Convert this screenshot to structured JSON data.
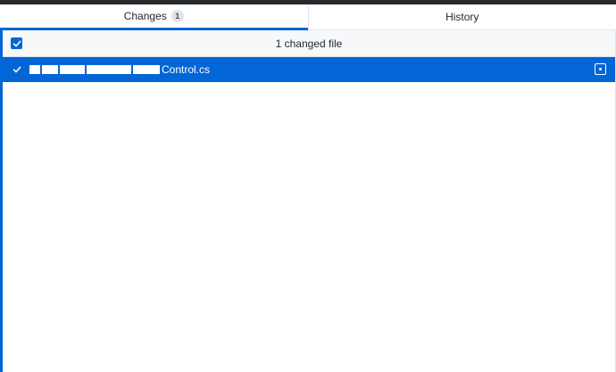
{
  "tabs": [
    {
      "label": "Changes",
      "count": "1",
      "selected": true
    },
    {
      "label": "History",
      "selected": false
    }
  ],
  "changes": {
    "summary": "1 changed file",
    "select_all_checked": true,
    "files": [
      {
        "name": "Control.cs",
        "checked": true,
        "selected": true,
        "status_icon": "file-modified-icon"
      }
    ]
  },
  "colors": {
    "accent": "#0366d6",
    "topbar": "#24292e",
    "header_bg": "#f6f8fa"
  }
}
